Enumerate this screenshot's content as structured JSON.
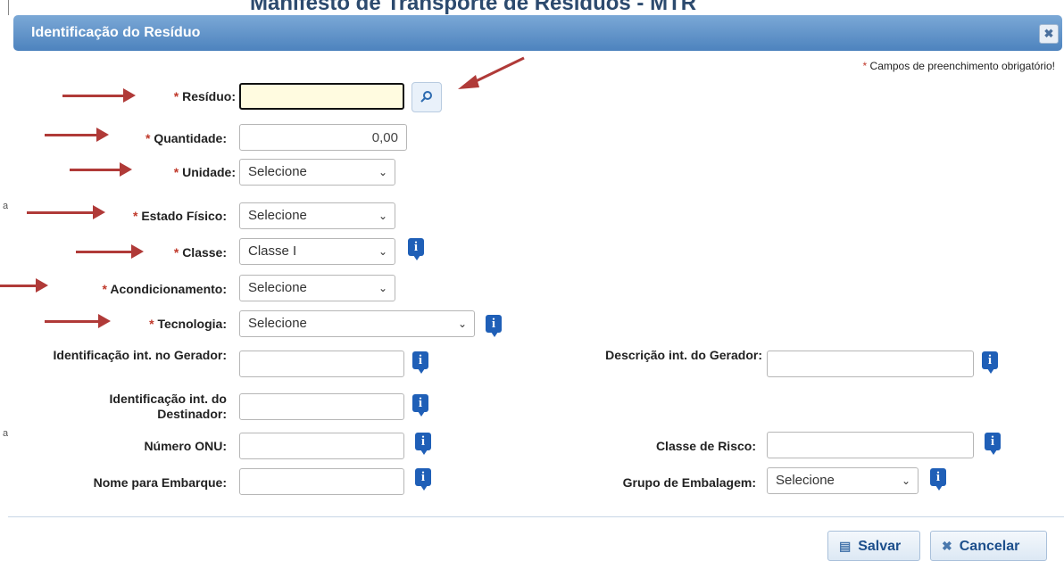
{
  "background": {
    "page_title": "Manifesto de Transporte de Resíduos - MTR"
  },
  "dialog": {
    "title": "Identificação do Resíduo",
    "close_icon": "close-icon",
    "required_note": "Campos de preenchimento obrigatório!",
    "required_mark": "*"
  },
  "fields": {
    "residuo": {
      "label": "Resíduo:",
      "value": ""
    },
    "quantidade": {
      "label": "Quantidade:",
      "value": "0,00"
    },
    "unidade": {
      "label": "Unidade:",
      "selected": "Selecione"
    },
    "estado_fisico": {
      "label": "Estado Físico:",
      "selected": "Selecione"
    },
    "classe": {
      "label": "Classe:",
      "selected": "Classe I"
    },
    "acondicionamento": {
      "label": "Acondicionamento:",
      "selected": "Selecione"
    },
    "tecnologia": {
      "label": "Tecnologia:",
      "selected": "Selecione"
    },
    "ident_gerador": {
      "label": "Identificação int. no Gerador:",
      "value": ""
    },
    "ident_destinador": {
      "label": "Identificação int. do Destinador:",
      "value": ""
    },
    "numero_onu": {
      "label": "Número ONU:",
      "value": ""
    },
    "nome_embarque": {
      "label": "Nome para Embarque:",
      "value": ""
    },
    "descricao_gerador": {
      "label": "Descrição int. do Gerador:",
      "value": ""
    },
    "classe_risco": {
      "label": "Classe de Risco:",
      "value": ""
    },
    "grupo_embalagem": {
      "label": "Grupo de Embalagem:",
      "selected": "Selecione"
    }
  },
  "buttons": {
    "save": "Salvar",
    "cancel": "Cancelar"
  },
  "colors": {
    "titlebar": "#4d83be",
    "required_star": "#c0392b",
    "annotation_arrow": "#b03a38",
    "info_icon": "#1f5fb7"
  }
}
